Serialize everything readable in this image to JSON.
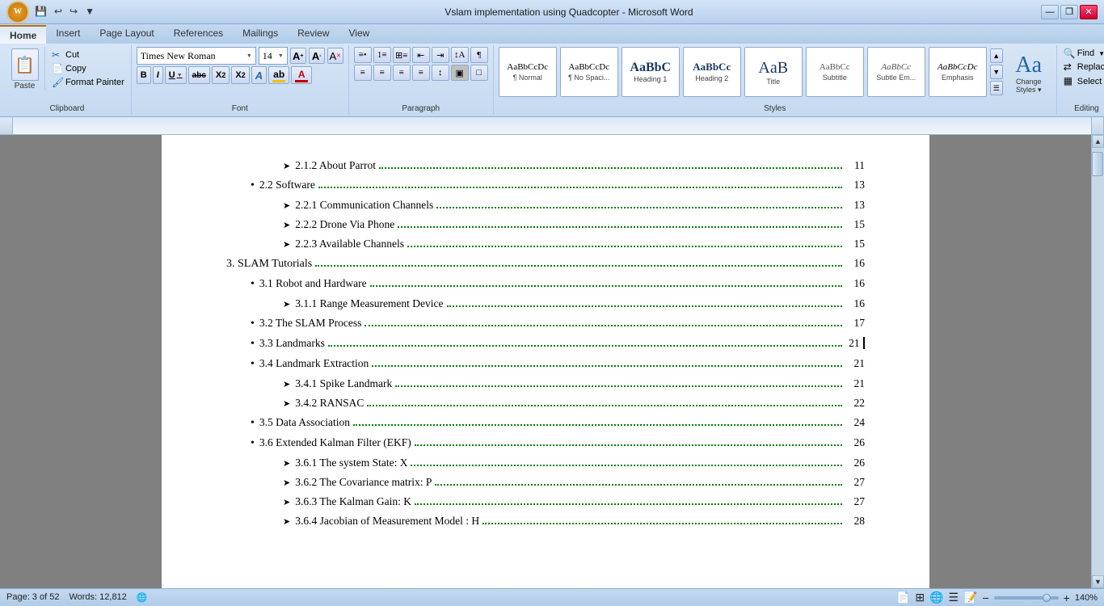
{
  "titleBar": {
    "title": "Vslam implementation using Quadcopter - Microsoft Word",
    "controls": [
      "—",
      "❐",
      "✕"
    ]
  },
  "quickAccess": {
    "buttons": [
      "💾",
      "↩",
      "↪",
      "▼"
    ]
  },
  "ribbonTabs": [
    "Home",
    "Insert",
    "Page Layout",
    "References",
    "Mailings",
    "Review",
    "View"
  ],
  "activeTab": "Home",
  "clipboard": {
    "paste": "Paste",
    "cut": "Cut",
    "copy": "Copy",
    "formatPainter": "Format Painter"
  },
  "font": {
    "name": "Times New Roman",
    "size": "14",
    "increaseSize": "A",
    "decreaseSize": "A",
    "clearFormat": "A"
  },
  "styles": [
    {
      "label": "Normal",
      "preview": "AaBbCcDc",
      "size": 11,
      "color": "#000"
    },
    {
      "label": "No Spaci...",
      "preview": "AaBbCcDc",
      "size": 11,
      "color": "#000"
    },
    {
      "label": "Heading 1",
      "preview": "AaBbC",
      "size": 16,
      "color": "#17375e",
      "bold": true
    },
    {
      "label": "Heading 2",
      "preview": "AaBbCc",
      "size": 13,
      "color": "#17375e",
      "bold": true
    },
    {
      "label": "Title",
      "preview": "AaB",
      "size": 20,
      "color": "#17375e"
    },
    {
      "label": "Subtitle",
      "preview": "AaBbCc",
      "size": 11,
      "color": "#555"
    },
    {
      "label": "Subtle Em...",
      "preview": "AaBbCc",
      "size": 11,
      "color": "#555",
      "italic": true
    },
    {
      "label": "Emphasis",
      "preview": "AaBbCcDc",
      "size": 11,
      "color": "#000",
      "italic": true
    }
  ],
  "changeStyles": "Change\nStyles",
  "editing": {
    "find": "Find",
    "replace": "Replace",
    "select": "Select ▾"
  },
  "statusBar": {
    "page": "Page: 3 of 52",
    "words": "Words: 12,812",
    "language": "🌐",
    "zoom": "140%"
  },
  "document": {
    "title": "Vslam implementation using Quadcopter",
    "toc": [
      {
        "level": 3,
        "marker": "➤",
        "text": "2.1.2 About Parrot",
        "page": "11"
      },
      {
        "level": 2,
        "marker": "•",
        "text": "2.2 Software",
        "page": "13"
      },
      {
        "level": 3,
        "marker": "➤",
        "text": "2.2.1 Communication Channels",
        "page": "13"
      },
      {
        "level": 3,
        "marker": "➤",
        "text": "2.2.2 Drone Via Phone",
        "page": "15"
      },
      {
        "level": 3,
        "marker": "➤",
        "text": "2.2.3 Available Channels",
        "page": "15"
      },
      {
        "level": 1,
        "marker": "",
        "text": "3.  SLAM Tutorials",
        "page": "16"
      },
      {
        "level": 2,
        "marker": "•",
        "text": "3.1 Robot and Hardware",
        "page": "16"
      },
      {
        "level": 3,
        "marker": "➤",
        "text": "3.1.1 Range Measurement Device",
        "page": "16"
      },
      {
        "level": 2,
        "marker": "•",
        "text": "3.2 The SLAM Process",
        "page": "17"
      },
      {
        "level": 2,
        "marker": "•",
        "text": "3.3 Landmarks",
        "page": "21",
        "cursor": true
      },
      {
        "level": 2,
        "marker": "•",
        "text": "3.4 Landmark Extraction",
        "page": "21"
      },
      {
        "level": 3,
        "marker": "➤",
        "text": "3.4.1 Spike Landmark",
        "page": "21"
      },
      {
        "level": 3,
        "marker": "➤",
        "text": "3.4.2 RANSAC",
        "page": "22"
      },
      {
        "level": 2,
        "marker": "•",
        "text": "3.5 Data Association",
        "page": "24"
      },
      {
        "level": 2,
        "marker": "•",
        "text": "3.6 Extended Kalman Filter (EKF)",
        "page": "26"
      },
      {
        "level": 3,
        "marker": "➤",
        "text": "3.6.1 The system State: X",
        "page": "26"
      },
      {
        "level": 3,
        "marker": "➤",
        "text": "3.6.2 The Covariance matrix: P",
        "page": "27"
      },
      {
        "level": 3,
        "marker": "➤",
        "text": "3.6.3 The Kalman Gain: K",
        "page": "27"
      },
      {
        "level": 3,
        "marker": "➤",
        "text": "3.6.4 Jacobian of Measurement Model : H",
        "page": "28"
      }
    ]
  }
}
